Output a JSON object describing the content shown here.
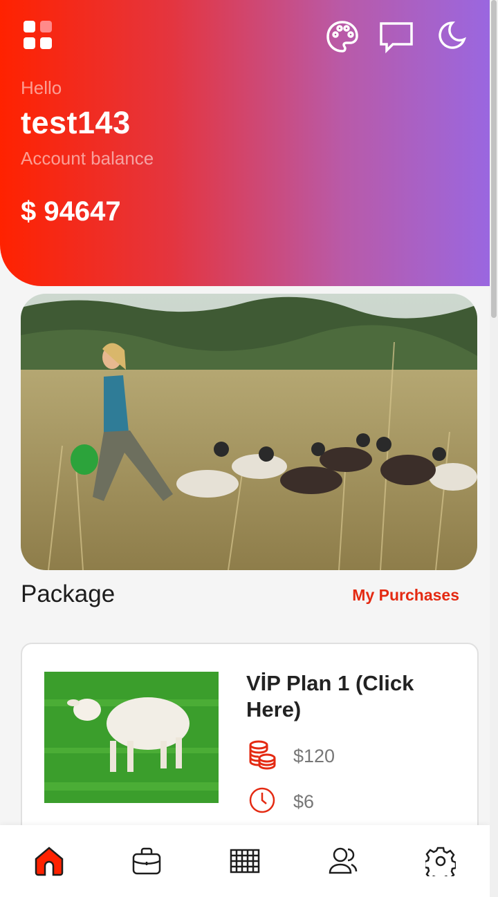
{
  "header": {
    "greeting": "Hello",
    "username": "test143",
    "balance_label": "Account balance",
    "balance": "$ 94647",
    "icons": [
      "grid-menu-icon",
      "palette-icon",
      "message-icon",
      "moon-icon"
    ]
  },
  "package": {
    "title": "Package",
    "link": "My Purchases",
    "plans": [
      {
        "name": "VİP Plan 1 (Click Here)",
        "price": "$120",
        "daily": "$6"
      }
    ]
  },
  "nav": {
    "items": [
      "home-icon",
      "briefcase-icon",
      "calendar-grid-icon",
      "users-icon",
      "settings-icon"
    ],
    "active_color": "#ff2200"
  },
  "colors": {
    "accent": "#ff2200",
    "gradient_end": "#9a67e0",
    "link": "#e42a12"
  }
}
